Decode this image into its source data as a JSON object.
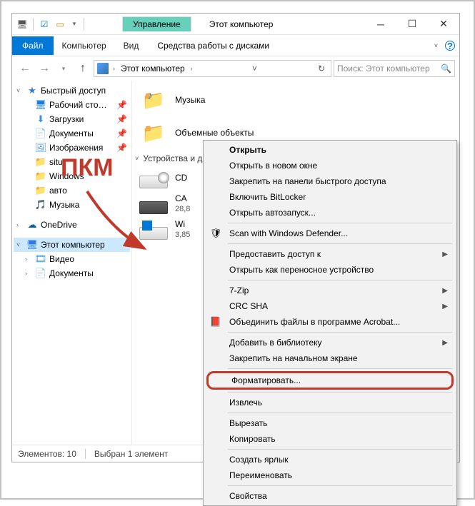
{
  "window": {
    "context_tab": "Управление",
    "title": "Этот компьютер"
  },
  "ribbon": {
    "file": "Файл",
    "tabs": [
      "Компьютер",
      "Вид"
    ],
    "context": "Средства работы с дисками"
  },
  "addressbar": {
    "root": "Этот компьютер"
  },
  "search": {
    "placeholder": "Поиск: Этот компьютер"
  },
  "nav": {
    "quick_access": "Быстрый доступ",
    "items_qa": [
      {
        "label": "Рабочий сто…",
        "icon": "desktop"
      },
      {
        "label": "Загрузки",
        "icon": "download"
      },
      {
        "label": "Документы",
        "icon": "document"
      },
      {
        "label": "Изображения",
        "icon": "picture"
      },
      {
        "label": "situ",
        "icon": "folder"
      },
      {
        "label": "Windows",
        "icon": "folder"
      },
      {
        "label": "авто",
        "icon": "folder"
      },
      {
        "label": "Музыка",
        "icon": "music"
      }
    ],
    "onedrive": "OneDrive",
    "this_pc": "Этот компьютер",
    "items_pc": [
      {
        "label": "Видео",
        "icon": "video"
      },
      {
        "label": "Документы",
        "icon": "document"
      }
    ]
  },
  "content": {
    "music": "Музыка",
    "objects3d": "Объемные объекты",
    "group_devices": "Устройства и д",
    "drives": [
      {
        "name": "CD",
        "sub": ""
      },
      {
        "name": "CA",
        "sub": "28,8"
      },
      {
        "name": "Wi",
        "sub": "3,85"
      }
    ]
  },
  "status": {
    "count": "Элементов: 10",
    "selected": "Выбран 1 элемент"
  },
  "context_menu": {
    "items": [
      {
        "label": "Открыть",
        "type": "item",
        "bold": true
      },
      {
        "label": "Открыть в новом окне",
        "type": "item"
      },
      {
        "label": "Закрепить на панели быстрого доступа",
        "type": "item"
      },
      {
        "label": "Включить BitLocker",
        "type": "item"
      },
      {
        "label": "Открыть автозапуск...",
        "type": "item"
      },
      {
        "type": "sep"
      },
      {
        "label": "Scan with Windows Defender...",
        "type": "item",
        "icon": "shield"
      },
      {
        "type": "sep"
      },
      {
        "label": "Предоставить доступ к",
        "type": "submenu"
      },
      {
        "label": "Открыть как переносное устройство",
        "type": "item"
      },
      {
        "type": "sep"
      },
      {
        "label": "7-Zip",
        "type": "submenu"
      },
      {
        "label": "CRC SHA",
        "type": "submenu"
      },
      {
        "label": "Объединить файлы в программе Acrobat...",
        "type": "item",
        "icon": "pdf"
      },
      {
        "type": "sep"
      },
      {
        "label": "Добавить в библиотеку",
        "type": "submenu"
      },
      {
        "label": "Закрепить на начальном экране",
        "type": "item"
      },
      {
        "type": "sep"
      },
      {
        "label": "Форматировать...",
        "type": "item",
        "highlight": true
      },
      {
        "type": "sep"
      },
      {
        "label": "Извлечь",
        "type": "item"
      },
      {
        "type": "sep"
      },
      {
        "label": "Вырезать",
        "type": "item"
      },
      {
        "label": "Копировать",
        "type": "item"
      },
      {
        "type": "sep"
      },
      {
        "label": "Создать ярлык",
        "type": "item"
      },
      {
        "label": "Переименовать",
        "type": "item"
      },
      {
        "type": "sep"
      },
      {
        "label": "Свойства",
        "type": "item"
      }
    ]
  },
  "annotation": {
    "text": "ПКМ"
  }
}
